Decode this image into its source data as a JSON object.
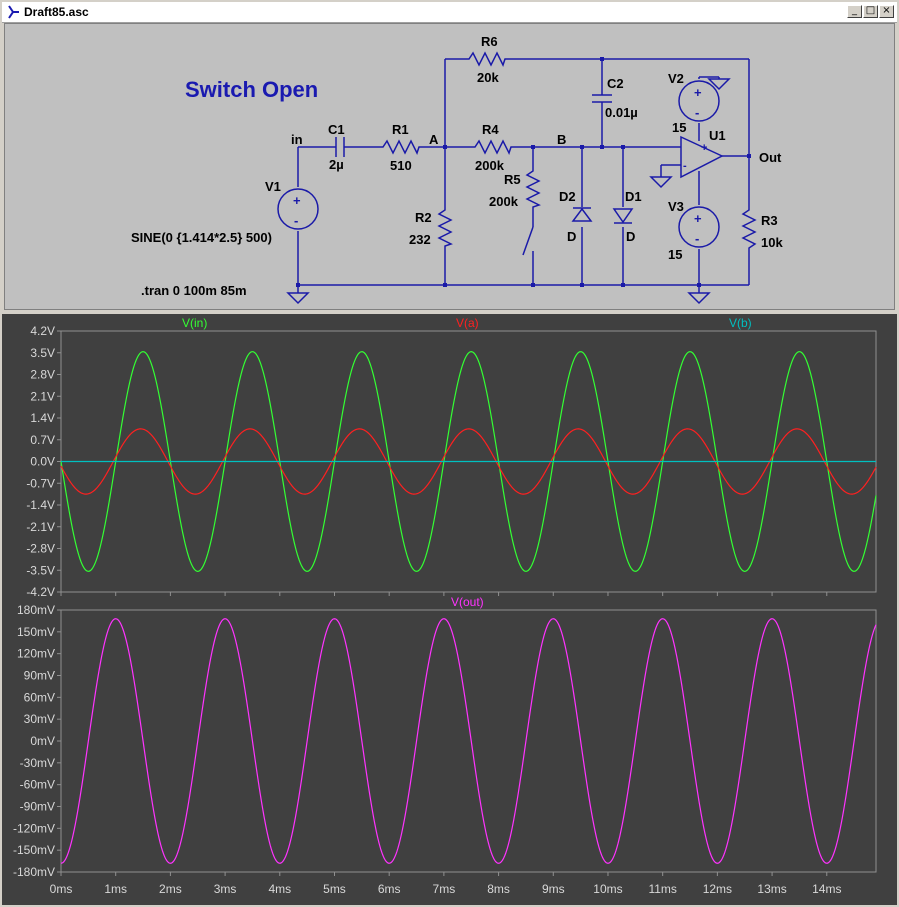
{
  "window": {
    "title": "Draft85.asc",
    "buttons": {
      "minimize": "_",
      "restore": "□",
      "close": "×"
    }
  },
  "schematic": {
    "heading": "Switch Open",
    "directive": ".tran 0 100m 85m",
    "source_spec": "SINE(0 {1.414*2.5} 500)",
    "nets": {
      "in": "in",
      "a": "A",
      "b": "B",
      "out": "Out"
    },
    "components": {
      "V1": {
        "name": "V1"
      },
      "C1": {
        "name": "C1",
        "value": "2µ"
      },
      "R1": {
        "name": "R1",
        "value": "510"
      },
      "R2": {
        "name": "R2",
        "value": "232"
      },
      "R4": {
        "name": "R4",
        "value": "200k"
      },
      "R5": {
        "name": "R5",
        "value": "200k"
      },
      "R6": {
        "name": "R6",
        "value": "20k"
      },
      "C2": {
        "name": "C2",
        "value": "0.01µ"
      },
      "D1": {
        "name": "D1",
        "value": "D"
      },
      "D2": {
        "name": "D2",
        "value": "D"
      },
      "V2": {
        "name": "V2",
        "value": "15"
      },
      "V3": {
        "name": "V3",
        "value": "15"
      },
      "U1": {
        "name": "U1",
        "plus": "+",
        "minus": "-"
      },
      "R3": {
        "name": "R3",
        "value": "10k"
      }
    }
  },
  "chart_data": [
    {
      "type": "line",
      "series": [
        {
          "name": "V(in)",
          "color": "#33ff33",
          "amplitude": 3.535,
          "frequency_hz": 500,
          "phase_deg": 180
        },
        {
          "name": "V(a)",
          "color": "#ff2020",
          "amplitude": 1.05,
          "frequency_hz": 500,
          "phase_deg": 188
        },
        {
          "name": "V(b)",
          "color": "#00c0c0",
          "amplitude": 0,
          "frequency_hz": 500,
          "phase_deg": 0
        }
      ],
      "ylim": [
        -4.2,
        4.2
      ],
      "xlim": [
        0,
        14.9
      ],
      "yticks": [
        "4.2V",
        "3.5V",
        "2.8V",
        "2.1V",
        "1.4V",
        "0.7V",
        "0.0V",
        "-0.7V",
        "-1.4V",
        "-2.1V",
        "-2.8V",
        "-3.5V",
        "-4.2V"
      ],
      "ytick_values": [
        4.2,
        3.5,
        2.8,
        2.1,
        1.4,
        0.7,
        0.0,
        -0.7,
        -1.4,
        -2.1,
        -2.8,
        -3.5,
        -4.2
      ],
      "grid": false
    },
    {
      "type": "line",
      "series": [
        {
          "name": "V(out)",
          "color": "#ff33ff",
          "amplitude": 168,
          "frequency_hz": 500,
          "phase_deg": 270
        }
      ],
      "ylim": [
        -180,
        180
      ],
      "xlim": [
        0,
        14.9
      ],
      "yticks": [
        "180mV",
        "150mV",
        "120mV",
        "90mV",
        "60mV",
        "30mV",
        "0mV",
        "-30mV",
        "-60mV",
        "-90mV",
        "-120mV",
        "-150mV",
        "-180mV"
      ],
      "ytick_values": [
        180,
        150,
        120,
        90,
        60,
        30,
        0,
        -30,
        -60,
        -90,
        -120,
        -150,
        -180
      ],
      "xticks": [
        "0ms",
        "1ms",
        "2ms",
        "3ms",
        "4ms",
        "5ms",
        "6ms",
        "7ms",
        "8ms",
        "9ms",
        "10ms",
        "11ms",
        "12ms",
        "13ms",
        "14ms"
      ],
      "xtick_values": [
        0,
        1,
        2,
        3,
        4,
        5,
        6,
        7,
        8,
        9,
        10,
        11,
        12,
        13,
        14
      ],
      "grid": false
    }
  ]
}
